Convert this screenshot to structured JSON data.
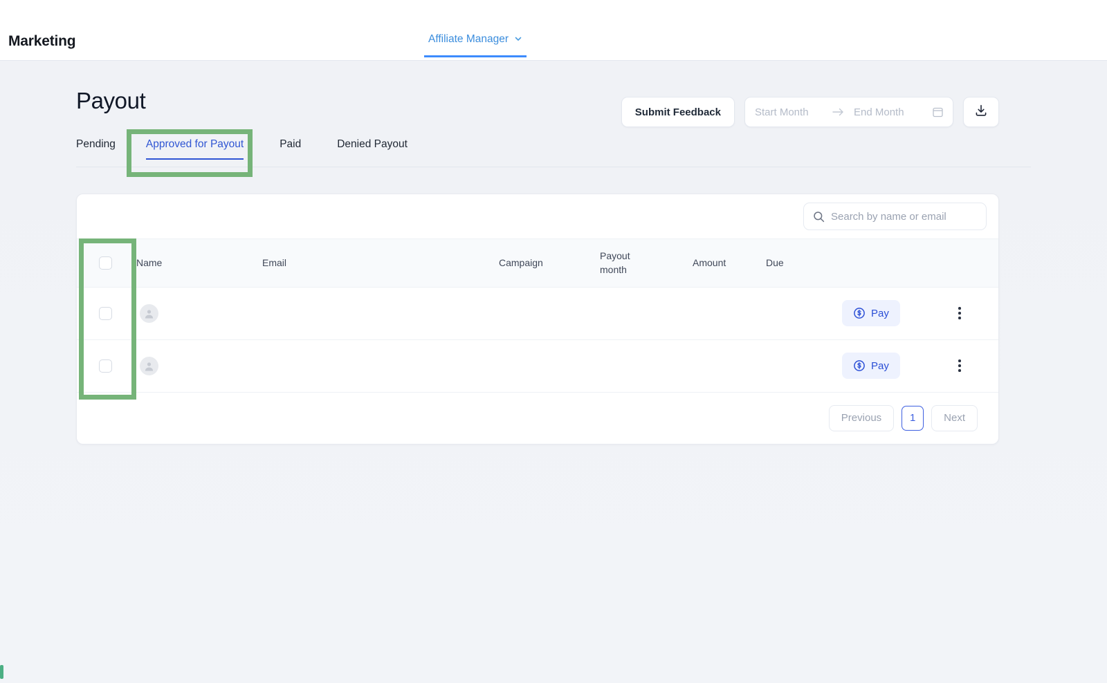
{
  "topbar": {
    "brand": "Marketing",
    "nav_label": "Affiliate Manager",
    "nav_chevron_icon": "chevron-down-icon"
  },
  "header": {
    "title": "Payout",
    "submit_feedback_label": "Submit Feedback",
    "start_month_placeholder": "Start Month",
    "range_arrow_icon": "arrow-right-icon",
    "end_month_placeholder": "End Month",
    "calendar_icon": "calendar-icon",
    "download_icon": "download-icon"
  },
  "tabs": [
    {
      "label": "Pending",
      "active": false
    },
    {
      "label": "Approved for Payout",
      "active": true
    },
    {
      "label": "Paid",
      "active": false
    },
    {
      "label": "Denied Payout",
      "active": false
    }
  ],
  "search": {
    "icon": "search-icon",
    "placeholder": "Search by name or email",
    "value": ""
  },
  "table": {
    "select_all_checkbox": "",
    "columns": [
      "Name",
      "Email",
      "Campaign",
      "Payout month",
      "Amount",
      "Due"
    ],
    "payout_month_line1": "Payout",
    "payout_month_line2": "month",
    "rows": [
      {
        "checkbox": "",
        "avatar_icon": "user-avatar-icon",
        "name": "",
        "email": "",
        "campaign": "",
        "payout_month": "",
        "amount": "",
        "due": "",
        "pay_label": "Pay",
        "pay_icon": "dollar-circle-icon",
        "menu_icon": "more-vertical-icon"
      },
      {
        "checkbox": "",
        "avatar_icon": "user-avatar-icon",
        "name": "",
        "email": "",
        "campaign": "",
        "payout_month": "",
        "amount": "",
        "due": "",
        "pay_label": "Pay",
        "pay_icon": "dollar-circle-icon",
        "menu_icon": "more-vertical-icon"
      }
    ]
  },
  "pagination": {
    "previous_label": "Previous",
    "current_page": "1",
    "next_label": "Next"
  },
  "highlights": {
    "color": "#76b479",
    "targets": [
      "approved-for-payout-tab",
      "row-select-checkbox-column"
    ]
  }
}
